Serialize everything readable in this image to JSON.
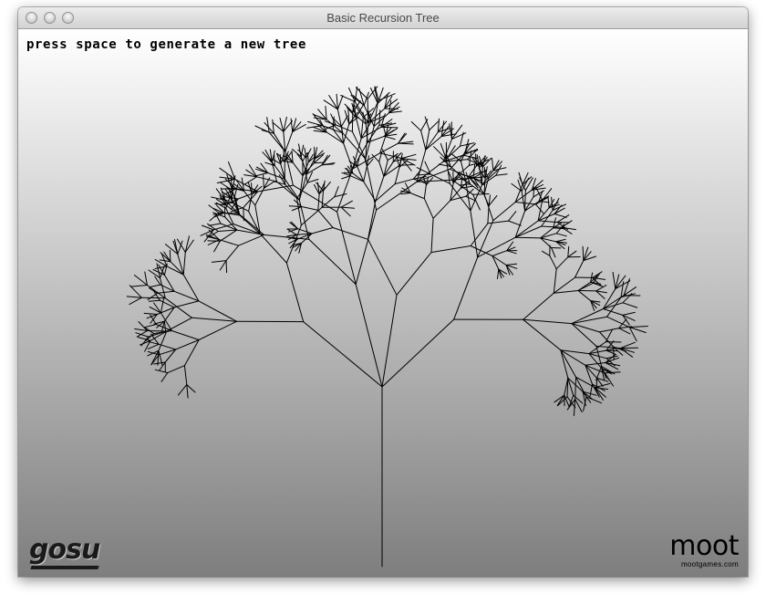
{
  "window": {
    "title": "Basic Recursion Tree"
  },
  "game": {
    "instruction": "press space to generate a new tree",
    "background_top": "#ffffff",
    "background_bottom": "#7e7e7e",
    "branch_color": "#000000"
  },
  "logos": {
    "gosu": "gosu",
    "moot_name": "moot",
    "moot_url": "mootgames.com"
  }
}
